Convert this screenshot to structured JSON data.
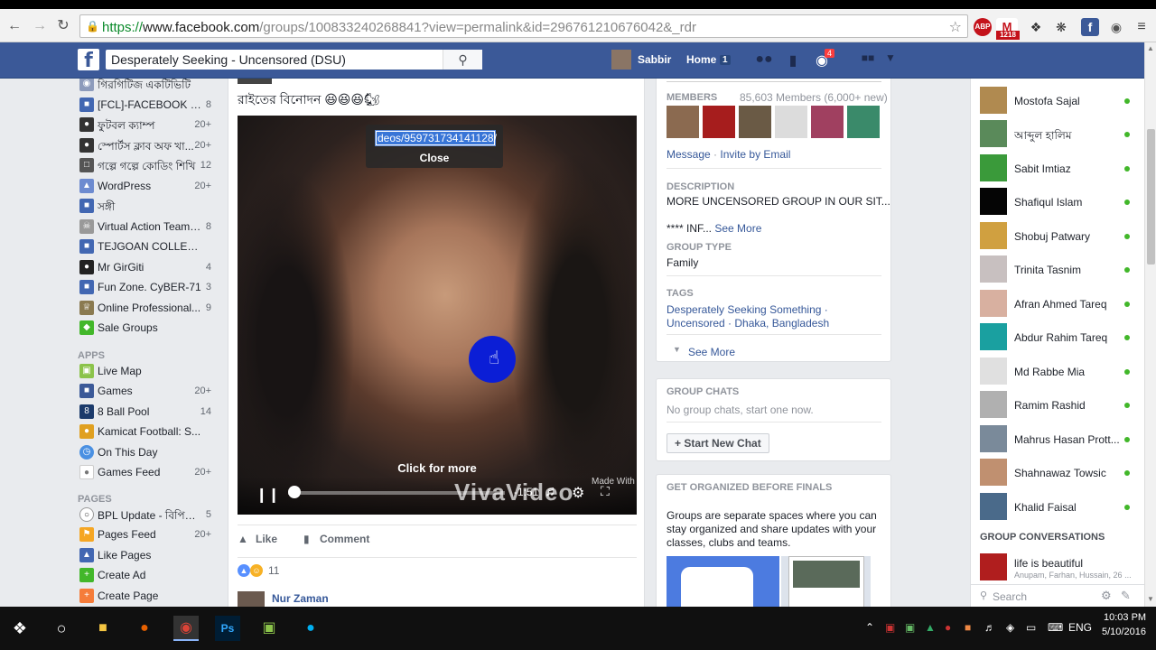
{
  "browser": {
    "url_scheme": "https://",
    "url_host": "www.facebook.com",
    "url_path": "/groups/100833240268841?view=permalink&id=296761210676042&_rdr",
    "ext_abp": "ABP",
    "ext_gmail_count": "1218"
  },
  "fb": {
    "search_value": "Desperately Seeking - Uncensored (DSU)",
    "user_name": "Sabbir",
    "home_label": "Home",
    "home_count": "1",
    "notif_count": "4"
  },
  "left": {
    "groups": [
      {
        "label": "গিরগিটিজ একটিভিটি",
        "count": ""
      },
      {
        "label": "[FCL]-FACEBOOK C...",
        "count": "8"
      },
      {
        "label": "ফুটবল ক্যাম্প",
        "count": "20+"
      },
      {
        "label": "স্পোর্টস ক্লাব অফ খা...",
        "count": "20+"
      },
      {
        "label": "গল্পে গল্পে কোডিং শিখি",
        "count": "12"
      },
      {
        "label": "WordPress",
        "count": "20+"
      },
      {
        "label": "সঙ্গী",
        "count": ""
      },
      {
        "label": "Virtual Action Team ...",
        "count": "8"
      },
      {
        "label": "TEJGOAN COLLEG...",
        "count": ""
      },
      {
        "label": "Mr GirGiti",
        "count": "4"
      },
      {
        "label": "Fun Zone. CyBER-71",
        "count": "3"
      },
      {
        "label": "Online Professional...",
        "count": "9"
      },
      {
        "label": "Sale Groups",
        "count": ""
      }
    ],
    "apps_header": "APPS",
    "apps": [
      {
        "label": "Live Map",
        "count": ""
      },
      {
        "label": "Games",
        "count": "20+"
      },
      {
        "label": "8 Ball Pool",
        "count": "14"
      },
      {
        "label": "Kamicat Football: S...",
        "count": ""
      },
      {
        "label": "On This Day",
        "count": ""
      },
      {
        "label": "Games Feed",
        "count": "20+"
      }
    ],
    "pages_header": "PAGES",
    "pages": [
      {
        "label": "BPL Update - বিপিএ...",
        "count": "5"
      },
      {
        "label": "Pages Feed",
        "count": "20+"
      },
      {
        "label": "Like Pages",
        "count": ""
      },
      {
        "label": "Create Ad",
        "count": ""
      },
      {
        "label": "Create Page",
        "count": ""
      }
    ]
  },
  "post": {
    "text": "রাইতের বিনোদন 😆😆😆🐿",
    "popup_url": "deos/959731734141128/",
    "popup_close": "Close",
    "click_for_more": "Click for more",
    "time": "-1:51",
    "watermark": "VivaVideo",
    "watermark_small": "Made With",
    "like_label": "Like",
    "comment_label": "Comment",
    "reaction_count": "11",
    "commenter": "Nur Zaman"
  },
  "right": {
    "members_title": "MEMBERS",
    "members_count": "85,603 Members (6,000+ new)",
    "message_link": "Message",
    "sep": "·",
    "invite_link": "Invite by Email",
    "description_title": "DESCRIPTION",
    "description_text": "MORE UNCENSORED GROUP IN OUR SIT...",
    "description_more_prefix": "**** INF...",
    "see_more": "See More",
    "group_type_title": "GROUP TYPE",
    "group_type": "Family",
    "tags_title": "TAGS",
    "tags_line1": "Desperately Seeking Something ·",
    "tags_line2": "Uncensored · Dhaka, Bangladesh",
    "see_more_2": "See More",
    "group_chats_title": "GROUP CHATS",
    "group_chats_text": "No group chats, start one now.",
    "start_chat": "+ Start New Chat",
    "organized_title": "GET ORGANIZED BEFORE FINALS",
    "organized_l1": "Groups are separate spaces where you can",
    "organized_l2": "stay organized and share updates with your",
    "organized_l3": "classes, clubs and teams."
  },
  "chat": {
    "contacts": [
      "Mostofa Sajal",
      "আব্দুল হালিম",
      "Sabit Imtiaz",
      "Shafiqul Islam",
      "Shobuj Patwary",
      "Trinita Tasnim",
      "Afran Ahmed Tareq",
      "Abdur Rahim Tareq",
      "Md Rabbe Mia",
      "Ramim Rashid",
      "Mahrus Hasan Prott...",
      "Shahnawaz Towsic",
      "Khalid Faisal"
    ],
    "group_conv_title": "GROUP CONVERSATIONS",
    "group_conv_name": "life is beautiful",
    "group_conv_members": "Anupam, Farhan, Hussain, 26 ...",
    "search_placeholder": "Search"
  },
  "taskbar": {
    "lang": "ENG",
    "time": "10:03 PM",
    "date": "5/10/2016"
  },
  "colors": {
    "fb_blue": "#3b5998",
    "link": "#365899",
    "online": "#42b72a"
  }
}
